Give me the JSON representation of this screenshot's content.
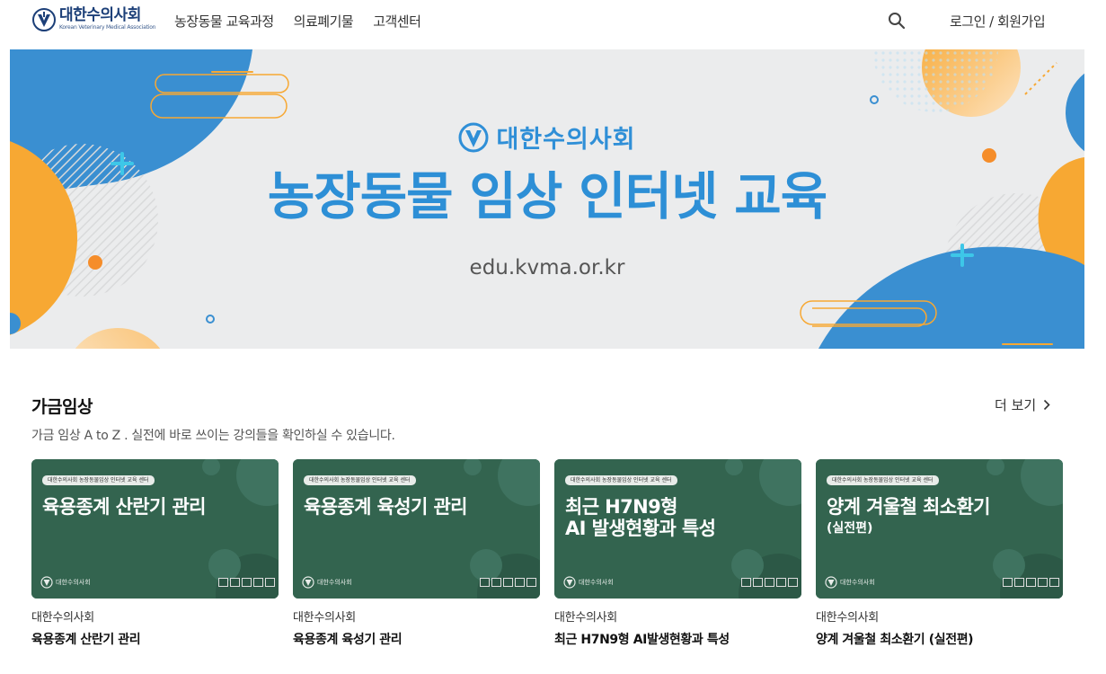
{
  "header": {
    "logo_name": "대한수의사회",
    "logo_sub": "Korean Veterinary Medical Association",
    "nav": [
      "농장동물 교육과정",
      "의료폐기물",
      "고객센터"
    ],
    "search_icon": "search-icon",
    "login_label": "로그인 / 회원가입"
  },
  "banner": {
    "brand": "대한수의사회",
    "title": "농장동물 임상 인터넷 교육",
    "url": "edu.kvma.or.kr"
  },
  "section": {
    "title": "가금임상",
    "more_label": "더 보기",
    "description": "가금 임상 A to Z . 실전에 바로 쓰이는 강의들을 확인하실 수 있습니다."
  },
  "cards": [
    {
      "thumb_tag": "대한수의사회 농장동물임상 인터넷 교육 센터",
      "thumb_title": "육용종계 산란기 관리",
      "thumb_title2": "",
      "thumb_sub": "",
      "thumb_logo": "대한수의사회",
      "author": "대한수의사회",
      "title": "육용종계 산란기 관리"
    },
    {
      "thumb_tag": "대한수의사회 농장동물임상 인터넷 교육 센터",
      "thumb_title": "육용종계 육성기 관리",
      "thumb_title2": "",
      "thumb_sub": "",
      "thumb_logo": "대한수의사회",
      "author": "대한수의사회",
      "title": "육용종계 육성기 관리"
    },
    {
      "thumb_tag": "대한수의사회 농장동물임상 인터넷 교육 센터",
      "thumb_title": "최근 H7N9형",
      "thumb_title2": "AI 발생현황과 특성",
      "thumb_sub": "",
      "thumb_logo": "대한수의사회",
      "author": "대한수의사회",
      "title": "최근 H7N9형 AI발생현황과 특성"
    },
    {
      "thumb_tag": "대한수의사회 농장동물임상 인터넷 교육 센터",
      "thumb_title": "양계 겨울철 최소환기",
      "thumb_title2": "",
      "thumb_sub": "(실전편)",
      "thumb_logo": "대한수의사회",
      "author": "대한수의사회",
      "title": "양계 겨울철 최소환기 (실전편)"
    }
  ],
  "colors": {
    "brand_blue": "#2d8fd6",
    "brand_navy": "#1c3f78",
    "accent_orange": "#f7a833",
    "card_green": "#33644f"
  }
}
